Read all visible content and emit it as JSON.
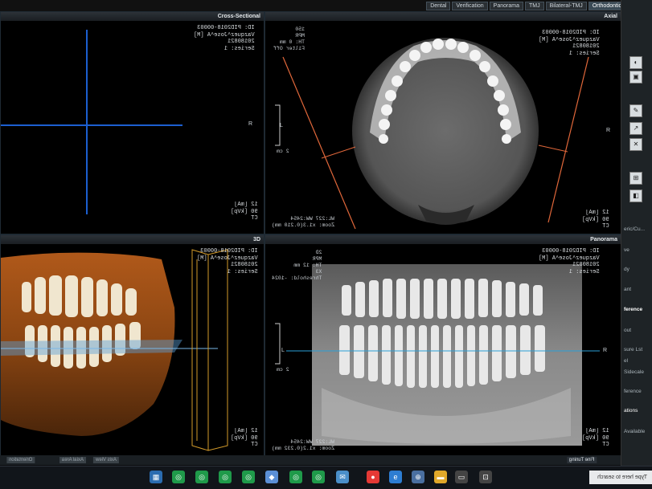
{
  "tabs": [
    "Dental",
    "Verification",
    "Panorama",
    "TMJ",
    "Bilateral-TMJ",
    "Orthodontic"
  ],
  "active_tab": "Orthodontic",
  "panels": {
    "cross": {
      "title": "Cross-Sectional",
      "meta_tr": "ID: PID2018-00003\nVazquez^Jose^A [M]\n20180821\nSeries: 1",
      "meta_br": "12 [mA]\n90 [kVp]\nCT",
      "meta_tl": "",
      "r_label": "R"
    },
    "axial": {
      "title": "Axial",
      "meta_tl": "150\nMPR\nTH: 0 mm\nFilter Off",
      "meta_tr": "ID: PID2018-00003\nVazquez^Jose^A [M]\n20180821\nSeries: 1",
      "meta_bl": "WL:227 WW:2454\nZoom: x1.3(0.210 mm)",
      "meta_br": "12 [mA]\n90 [kVp]\nCT",
      "scale": "2 cm",
      "l_label": "L",
      "r_label": "R"
    },
    "threed": {
      "title": "3D",
      "meta_tr": "ID: PID2018-00003\nVazquez^Jose^A [M]\n20180821\nSeries: 1",
      "meta_br": "12 [mA]\n90 [kVp]\nCT"
    },
    "pano": {
      "title": "Panorama",
      "meta_tl": "2D\nMPR\nTH: 12 mm\nX3\nThreshold: -1024",
      "meta_tr": "ID: PID2018-00003\nVazquez^Jose^A [M]\n20180821\nSeries: 1",
      "meta_bl": "WL:227 WW:2454\nZoom: x1.2(0.232 mm)",
      "meta_br": "12 [mA]\n90 [kVp]\nCT",
      "scale": "2 cm",
      "l_label": "L",
      "r_label": "R"
    }
  },
  "fine_tuning": "Fine Tuning",
  "right_panel_items": [
    "eric/Cu...",
    "ve",
    "dy",
    "ant",
    "ference",
    "out",
    "sure Lst",
    "el",
    "Sidecale",
    "ference",
    "ations",
    "Available"
  ],
  "search_placeholder": "Type here to search",
  "status_buttons": [
    "Axis View",
    "Axial Area",
    "Orientation"
  ]
}
